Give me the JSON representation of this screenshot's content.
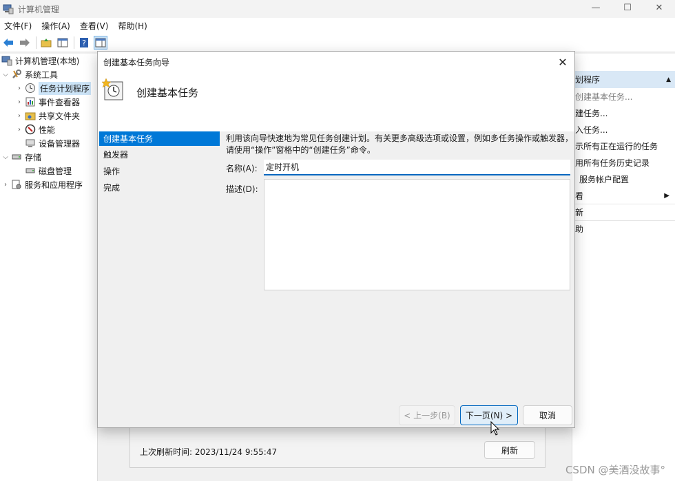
{
  "window": {
    "title": "计算机管理",
    "minimize": "—",
    "maximize": "☐",
    "close": "✕"
  },
  "menu": {
    "file": "文件(F)",
    "action": "操作(A)",
    "view": "查看(V)",
    "help": "帮助(H)"
  },
  "tree": {
    "root": "计算机管理(本地)",
    "system_tools": "系统工具",
    "task_scheduler": "任务计划程序",
    "event_viewer": "事件查看器",
    "shared_folders": "共享文件夹",
    "performance": "性能",
    "device_manager": "设备管理器",
    "storage": "存储",
    "disk_management": "磁盘管理",
    "services_apps": "服务和应用程序"
  },
  "actions": {
    "header": "划程序",
    "items": [
      "创建基本任务...",
      "建任务...",
      "入任务...",
      "示所有正在运行的任务",
      "用所有任务历史记录",
      "服务帐户配置",
      "看",
      "新",
      "助"
    ]
  },
  "bottom": {
    "overflow_text": "    ",
    "last_refresh": "上次刷新时间: 2023/11/24 9:55:47",
    "refresh": "刷新"
  },
  "dialog": {
    "title": "创建基本任务向导",
    "close": "✕",
    "header": "创建基本任务",
    "steps": [
      "创建基本任务",
      "触发器",
      "操作",
      "完成"
    ],
    "intro": "利用该向导快速地为常见任务创建计划。有关更多高级选项或设置，例如多任务操作或触发器，请使用“操作”窗格中的“创建任务”命令。",
    "name_label": "名称(A):",
    "name_value": "定时开机",
    "desc_label": "描述(D):",
    "desc_value": "",
    "prev": "< 上一步(B)",
    "next": "下一页(N) >",
    "cancel": "取消"
  },
  "watermark": "CSDN @美酒没故事°",
  "colors": {
    "accent": "#0078d7",
    "selection": "#cce4f7",
    "focus_border": "#0067c0"
  }
}
